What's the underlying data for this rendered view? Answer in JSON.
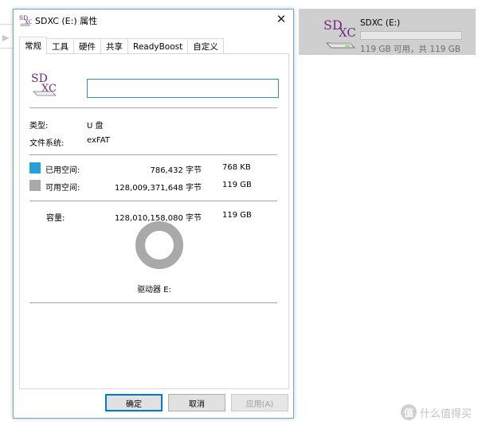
{
  "explorer": {
    "drive_name": "SDXC (E:)",
    "free_text": "119 GB 可用，共 119 GB",
    "used_fraction": 0.0
  },
  "dialog": {
    "title": "SDXC (E:) 属性",
    "close_glyph": "✕",
    "tabs": [
      {
        "label": "常规"
      },
      {
        "label": "工具"
      },
      {
        "label": "硬件"
      },
      {
        "label": "共享"
      },
      {
        "label": "ReadyBoost"
      },
      {
        "label": "自定义"
      }
    ],
    "general": {
      "name_value": "",
      "type_label": "类型:",
      "type_value": "U 盘",
      "fs_label": "文件系统:",
      "fs_value": "exFAT",
      "used_label": "已用空间:",
      "used_bytes": "786,432 字节",
      "used_size": "768 KB",
      "free_label": "可用空间:",
      "free_bytes": "128,009,371,648 字节",
      "free_size": "119 GB",
      "capacity_label": "容量:",
      "capacity_bytes": "128,010,158,080 字节",
      "capacity_size": "119 GB",
      "drive_label": "驱动器 E:",
      "used_fraction": 6e-06
    },
    "buttons": {
      "ok": "确定",
      "cancel": "取消",
      "apply": "应用(A)"
    }
  },
  "watermark": {
    "badge": "值",
    "text": "什么值得买"
  },
  "icon_text": {
    "sd": "SD",
    "xc": "XC"
  },
  "colors": {
    "used": "#26a0da",
    "free": "#a9a9a9",
    "sd_logo": "#6b2a7a",
    "accent": "#0078d7"
  }
}
